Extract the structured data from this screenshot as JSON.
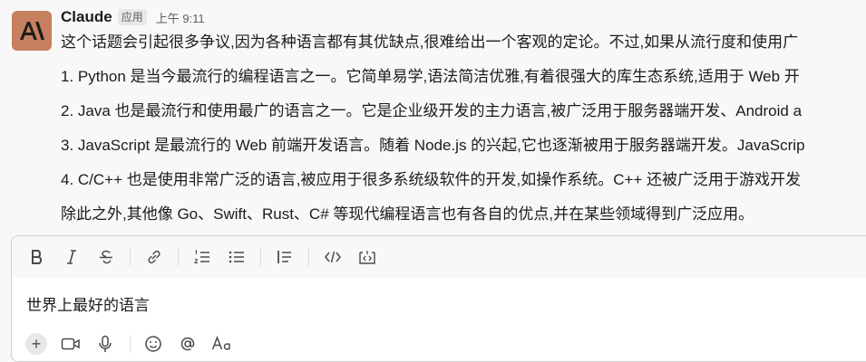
{
  "message": {
    "sender": "Claude",
    "badge": "应用",
    "timestamp": "上午 9:11",
    "lines": [
      "这个话题会引起很多争议,因为各种语言都有其优缺点,很难给出一个客观的定论。不过,如果从流行度和使用广",
      "1. Python 是当今最流行的编程语言之一。它简单易学,语法简洁优雅,有着很强大的库生态系统,适用于 Web 开",
      "2. Java 也是最流行和使用最广的语言之一。它是企业级开发的主力语言,被广泛用于服务器端开发、Android a",
      "3. JavaScript 是最流行的 Web 前端开发语言。随着 Node.js 的兴起,它也逐渐被用于服务器端开发。JavaScrip",
      "4. C/C++ 也是使用非常广泛的语言,被应用于很多系统级软件的开发,如操作系统。C++ 还被广泛用于游戏开发",
      "除此之外,其他像 Go、Swift、Rust、C# 等现代编程语言也有各自的优点,并在某些领域得到广泛应用。"
    ]
  },
  "composer": {
    "text": "世界上最好的语言",
    "toolbar": {
      "bold_icon": "bold-icon",
      "italic_icon": "italic-icon",
      "strike_icon": "strikethrough-icon",
      "link_icon": "link-icon",
      "ordered_list_icon": "ordered-list-icon",
      "bullet_list_icon": "bullet-list-icon",
      "blockquote_icon": "blockquote-icon",
      "code_icon": "code-icon",
      "code_block_icon": "code-block-icon"
    }
  },
  "colors": {
    "avatar_bg": "#c4805f",
    "background": "#f8f8f8",
    "text": "#1d1c1d",
    "muted": "#616061"
  }
}
